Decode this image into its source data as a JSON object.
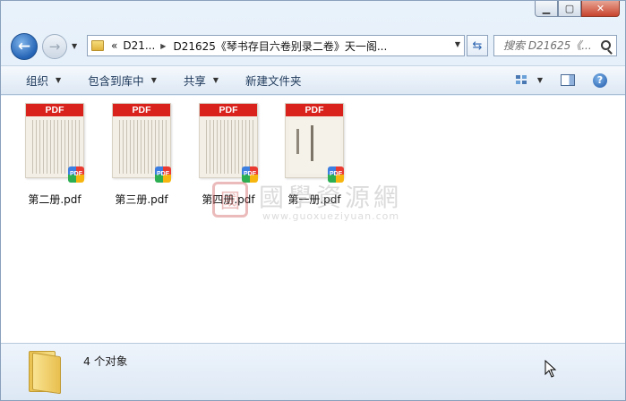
{
  "window": {
    "caption": {
      "minimize": "▁",
      "maximize": "▢",
      "close": "✕"
    }
  },
  "nav": {
    "back_icon": "back-arrow-icon",
    "forward_icon": "forward-arrow-icon",
    "breadcrumb": {
      "overflow": "«",
      "parent": "D21...",
      "current": "D21625《琴书存目六卷别录二卷》天一阁..."
    },
    "search_placeholder": "搜索 D21625《..."
  },
  "toolbar": {
    "organize": "组织",
    "include_library": "包含到库中",
    "share": "共享",
    "new_folder": "新建文件夹"
  },
  "files": [
    {
      "name": "第二册.pdf",
      "badge": "PDF",
      "band": "PDF"
    },
    {
      "name": "第三册.pdf",
      "badge": "PDF",
      "band": "PDF"
    },
    {
      "name": "第四册.pdf",
      "badge": "PDF",
      "band": "PDF"
    },
    {
      "name": "第一册.pdf",
      "badge": "PDF",
      "band": "PDF"
    }
  ],
  "watermark": {
    "logo": "國",
    "title": "國學資源網",
    "url": "www.guoxueziyuan.com"
  },
  "details": {
    "count_text": "4 个对象"
  },
  "colors": {
    "pdf_band": "#d9221c",
    "accent": "#2463b5"
  }
}
